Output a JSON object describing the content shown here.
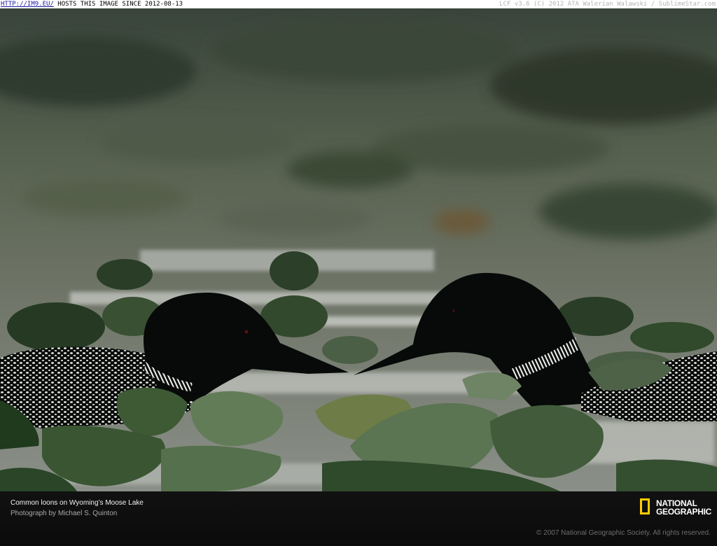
{
  "banner": {
    "link_text": "HTTP://IM9.EU/",
    "host_text": " HOSTS THIS IMAGE SINCE 2012-08-13",
    "credit_text": "LCF v3.6 (C) 2012 ATA Walerian Walawski / SublimeStar.com"
  },
  "photo": {
    "description": "Two common loons facing each other among lily pads"
  },
  "caption": {
    "title": "Common loons on Wyoming’s Moose Lake",
    "credit": "Photograph by Michael S. Quinton",
    "copyright": "© 2007 National Geographic Society. All rights reserved."
  },
  "logo": {
    "line1": "NATIONAL",
    "line2": "GEOGRAPHIC",
    "frame_color": "#ffcc00"
  }
}
